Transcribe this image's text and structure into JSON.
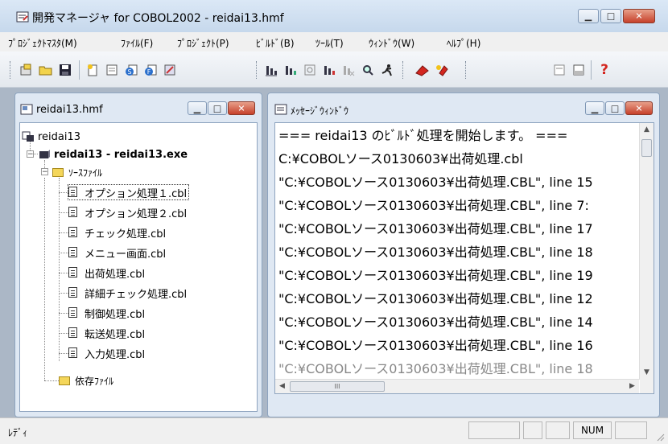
{
  "window": {
    "title": "開発マネージャ for COBOL2002 - reidai13.hmf"
  },
  "menu": [
    "ﾌﾟﾛｼﾞｪｸﾄﾏｽﾀ(M)",
    "ﾌｧｲﾙ(F)",
    "ﾌﾟﾛｼﾞｪｸﾄ(P)",
    "ﾋﾞﾙﾄﾞ(B)",
    "ﾂｰﾙ(T)",
    "ｳｨﾝﾄﾞｳ(W)",
    "ﾍﾙﾌﾟ(H)"
  ],
  "toolbar_icons": [
    "new-project-icon",
    "open-icon",
    "save-icon",
    "new-file-icon",
    "file-list-icon",
    "add-file-icon",
    "add-folder-icon",
    "properties-icon",
    "build-icon",
    "rebuild-icon",
    "build-options-icon",
    "build-all-icon",
    "clean-icon",
    "search-icon",
    "run-icon",
    "debug-icon",
    "tool-icon",
    "window-icon",
    "layout-icon",
    "help-icon"
  ],
  "project_window": {
    "title": "reidai13.hmf",
    "root": "reidai13",
    "project": "reidai13 - reidai13.exe",
    "source_folder": "ｿｰｽﾌｧｲﾙ",
    "files": [
      "オプション処理１.cbl",
      "オプション処理２.cbl",
      "チェック処理.cbl",
      "メニュー画面.cbl",
      "出荷処理.cbl",
      "詳細チェック処理.cbl",
      "制御処理.cbl",
      "転送処理.cbl",
      "入力処理.cbl"
    ],
    "dependency_folder": "依存ﾌｧｲﾙ"
  },
  "message_window": {
    "title": "ﾒｯｾｰｼﾞｳｨﾝﾄﾞｳ",
    "lines": [
      "=== reidai13 のﾋﾞﾙﾄﾞ処理を開始します。 ===",
      "C:¥COBOLソース0130603¥出荷処理.cbl",
      "\"C:¥COBOLソース0130603¥出荷処理.CBL\", line 15",
      "\"C:¥COBOLソース0130603¥出荷処理.CBL\", line 7:",
      "\"C:¥COBOLソース0130603¥出荷処理.CBL\", line 17",
      "\"C:¥COBOLソース0130603¥出荷処理.CBL\", line 18",
      "\"C:¥COBOLソース0130603¥出荷処理.CBL\", line 19",
      "\"C:¥COBOLソース0130603¥出荷処理.CBL\", line 12",
      "\"C:¥COBOLソース0130603¥出荷処理.CBL\", line 14",
      "\"C:¥COBOLソース0130603¥出荷処理.CBL\", line 16"
    ],
    "hscroll_glyph": "III"
  },
  "status": {
    "text": "ﾚﾃﾞｨ",
    "num": "NUM"
  }
}
